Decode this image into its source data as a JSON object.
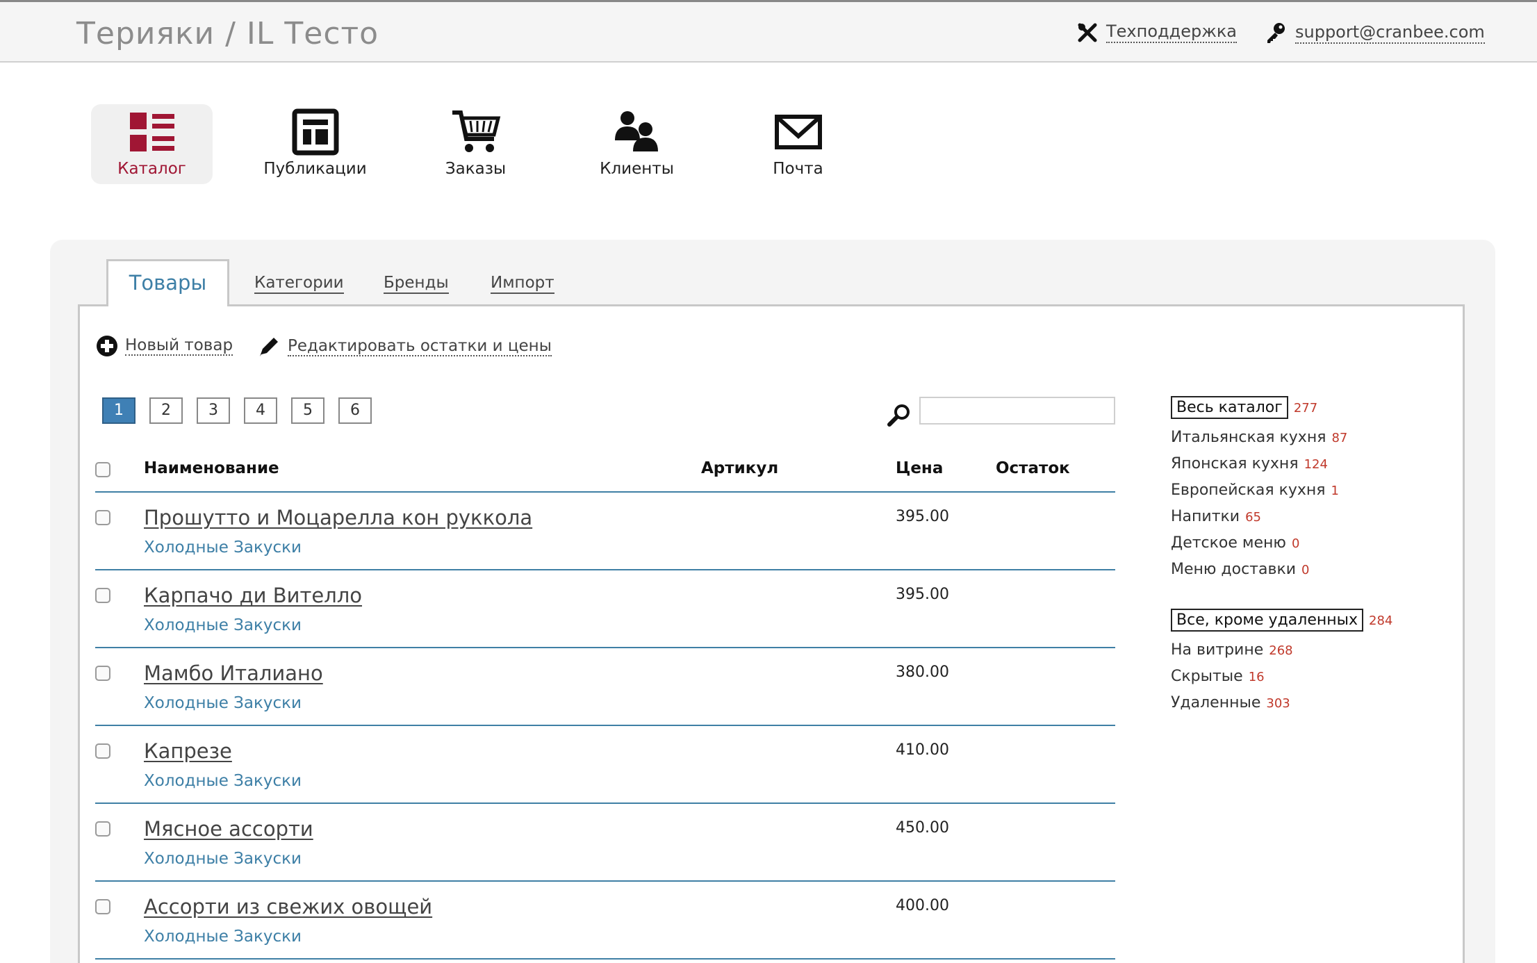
{
  "header": {
    "title": "Терияки / IL Тесто",
    "support_label": "Техподдержка",
    "email": "support@cranbee.com"
  },
  "nav": [
    {
      "label": "Каталог",
      "active": true,
      "icon": "catalog-icon"
    },
    {
      "label": "Публикации",
      "active": false,
      "icon": "publications-icon"
    },
    {
      "label": "Заказы",
      "active": false,
      "icon": "cart-icon"
    },
    {
      "label": "Клиенты",
      "active": false,
      "icon": "clients-icon"
    },
    {
      "label": "Почта",
      "active": false,
      "icon": "mail-icon"
    }
  ],
  "tabs": {
    "products": "Товары",
    "categories": "Категории",
    "brands": "Бренды",
    "import": "Импорт"
  },
  "actions": {
    "new_product": "Новый товар",
    "edit_stock": "Редактировать остатки и цены"
  },
  "pagination": {
    "pages": [
      "1",
      "2",
      "3",
      "4",
      "5",
      "6"
    ],
    "current": "1"
  },
  "search": {
    "value": "",
    "placeholder": ""
  },
  "table": {
    "headers": {
      "name": "Наименование",
      "sku": "Артикул",
      "price": "Цена",
      "stock": "Остаток"
    },
    "rows": [
      {
        "name": "Прошутто и Моцарелла кон руккола",
        "category": "Холодные Закуски",
        "price": "395.00"
      },
      {
        "name": "Карпачо ди Вителло",
        "category": "Холодные Закуски",
        "price": "395.00"
      },
      {
        "name": "Мамбо Италиано",
        "category": "Холодные Закуски",
        "price": "380.00"
      },
      {
        "name": "Капрезе",
        "category": "Холодные Закуски",
        "price": "410.00"
      },
      {
        "name": "Мясное ассорти",
        "category": "Холодные Закуски",
        "price": "450.00"
      },
      {
        "name": "Ассорти из свежих овощей",
        "category": "Холодные Закуски",
        "price": "400.00"
      }
    ]
  },
  "filters": {
    "catalog": [
      {
        "label": "Весь каталог",
        "count": "277",
        "selected": true
      },
      {
        "label": "Итальянская кухня",
        "count": "87"
      },
      {
        "label": "Японская кухня",
        "count": "124"
      },
      {
        "label": "Европейская кухня",
        "count": "1"
      },
      {
        "label": "Напитки",
        "count": "65"
      },
      {
        "label": "Детское меню",
        "count": "0"
      },
      {
        "label": "Меню доставки",
        "count": "0"
      }
    ],
    "status": [
      {
        "label": "Все, кроме удаленных",
        "count": "284",
        "selected": true
      },
      {
        "label": "На витрине",
        "count": "268"
      },
      {
        "label": "Скрытые",
        "count": "16"
      },
      {
        "label": "Удаленные",
        "count": "303"
      }
    ]
  },
  "colors": {
    "accent": "#a01634",
    "link_blue": "#3d7fa6",
    "count_red": "#c0392b",
    "pager_active": "#3f80b5"
  }
}
